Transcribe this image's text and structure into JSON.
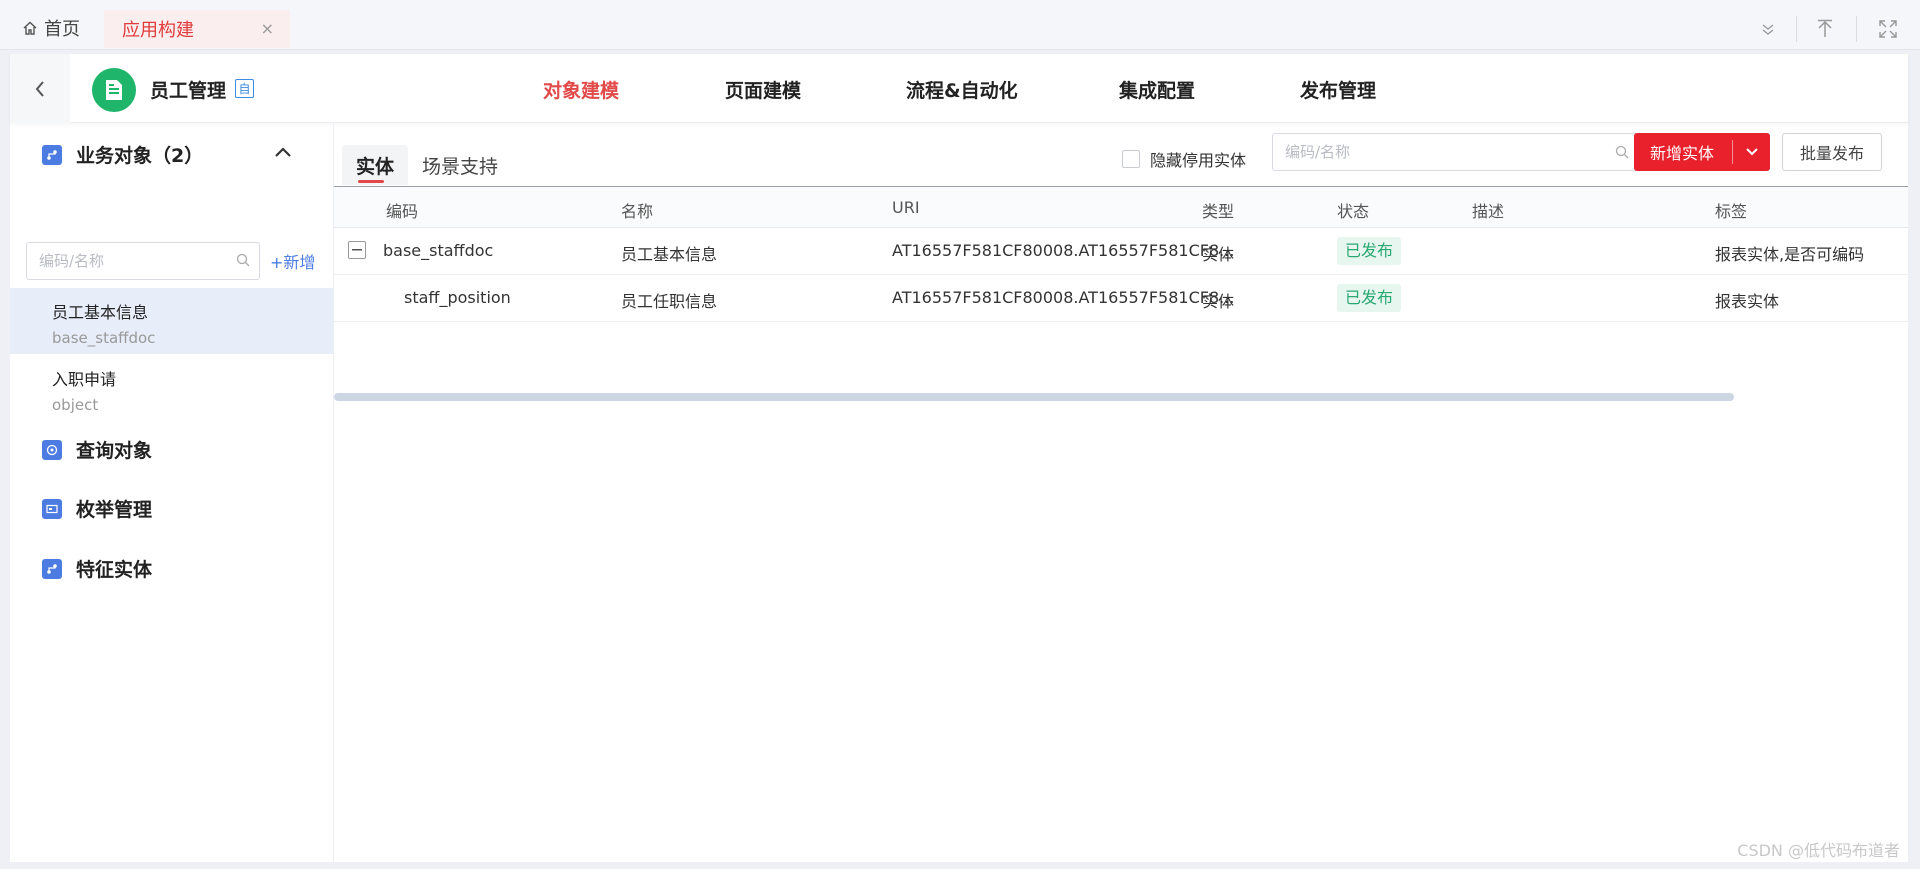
{
  "tabs": {
    "home": "首页",
    "app": "应用构建",
    "close": "×"
  },
  "app": {
    "name": "员工管理",
    "badge": "自"
  },
  "topnav": [
    "对象建模",
    "页面建模",
    "流程&自动化",
    "集成配置",
    "发布管理"
  ],
  "sidebar": {
    "section_business": "业务对象（2）",
    "search_placeholder": "编码/名称",
    "add_label": "新增",
    "items": [
      {
        "name": "员工基本信息",
        "code": "base_staffdoc"
      },
      {
        "name": "入职申请",
        "code": "object"
      }
    ],
    "section_query": "查询对象",
    "section_enum": "枚举管理",
    "section_feature": "特征实体"
  },
  "content": {
    "tab_entity": "实体",
    "tab_scene": "场景支持",
    "hide_label": "隐藏停用实体",
    "search_placeholder": "编码/名称",
    "new_button": "新增实体",
    "batch_button": "批量发布",
    "columns": [
      "编码",
      "名称",
      "URI",
      "类型",
      "状态",
      "描述",
      "标签"
    ],
    "rows": [
      {
        "code": "base_staffdoc",
        "name": "员工基本信息",
        "uri": "AT16557F581CF80008.AT16557F581CF8...",
        "type": "实体",
        "status": "已发布",
        "desc": "",
        "tags": "报表实体,是否可编码"
      },
      {
        "code": "staff_position",
        "name": "员工任职信息",
        "uri": "AT16557F581CF80008.AT16557F581CF8...",
        "type": "实体",
        "status": "已发布",
        "desc": "",
        "tags": "报表实体"
      }
    ]
  },
  "watermark": "CSDN @低代码布道者",
  "colors": {
    "accent": "#e8212d",
    "primary": "#4c7ce2",
    "success": "#2aa872",
    "logo": "#1fb56b"
  }
}
